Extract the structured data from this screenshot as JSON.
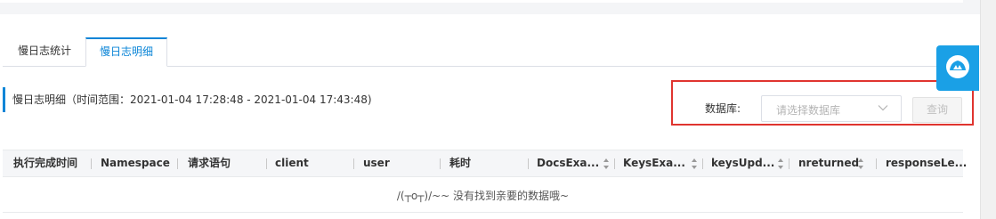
{
  "tabs": [
    {
      "label": "慢日志统计",
      "active": false
    },
    {
      "label": "慢日志明细",
      "active": true
    }
  ],
  "section": {
    "title": "慢日志明细（时间范围：2021-01-04 17:28:48 - 2021-01-04 17:43:48)"
  },
  "filters": {
    "db_label": "数据库:",
    "db_placeholder": "请选择数据库",
    "query_label": "查询"
  },
  "table": {
    "columns": [
      {
        "label": "执行完成时间",
        "sortable": false
      },
      {
        "label": "Namespace",
        "sortable": false
      },
      {
        "label": "请求语句",
        "sortable": false
      },
      {
        "label": "client",
        "sortable": false
      },
      {
        "label": "user",
        "sortable": false
      },
      {
        "label": "耗时",
        "sortable": false
      },
      {
        "label": "DocsExa...",
        "sortable": true
      },
      {
        "label": "KeysExa...",
        "sortable": true
      },
      {
        "label": "keysUpd...",
        "sortable": true
      },
      {
        "label": "nreturned",
        "sortable": true
      },
      {
        "label": "responseLe...",
        "sortable": false
      }
    ],
    "empty_text": "/(┬o┬)/~~ 没有找到亲要的数据哦~"
  },
  "colors": {
    "accent": "#0b85d7",
    "highlight": "#e0342f",
    "help_badge": "#1aa0e6"
  },
  "icons": {
    "help": "help-badge-icon",
    "dropdown": "chevron-down-icon",
    "sort": "sort-icon"
  }
}
